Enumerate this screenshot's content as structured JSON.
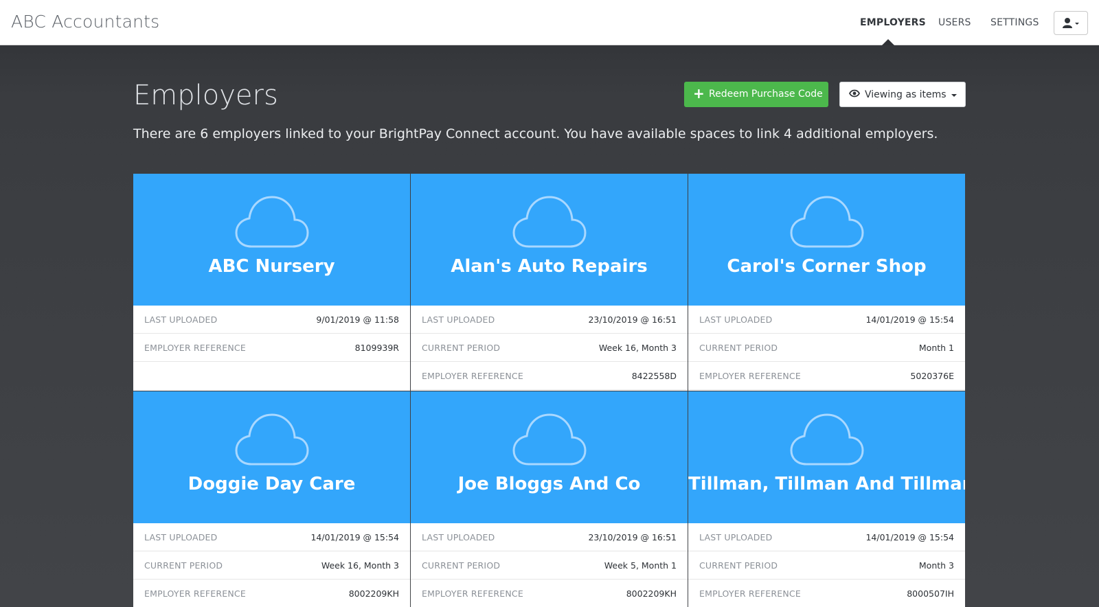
{
  "app": {
    "title": "ABC Accountants"
  },
  "nav": {
    "items": [
      {
        "label": "EMPLOYERS",
        "active": true
      },
      {
        "label": "USERS",
        "active": false
      },
      {
        "label": "SETTINGS",
        "active": false
      }
    ],
    "user_icon": "user-icon"
  },
  "page": {
    "title": "Employers",
    "intro": "There are 6 employers linked to your BrightPay Connect account. You have available spaces to link 4 additional employers."
  },
  "actions": {
    "redeem_label": "Redeem Purchase Code",
    "view_label": "Viewing as items"
  },
  "colors": {
    "card_accent": "#33a6fb",
    "redeem_button": "#4cb84c"
  },
  "employers": [
    {
      "name": "ABC Nursery",
      "rows": [
        {
          "key": "LAST UPLOADED",
          "value": "9/01/2019 @ 11:58"
        },
        {
          "key": "EMPLOYER REFERENCE",
          "value": "8109939R"
        }
      ]
    },
    {
      "name": "Alan's Auto Repairs",
      "rows": [
        {
          "key": "LAST UPLOADED",
          "value": "23/10/2019 @ 16:51"
        },
        {
          "key": "CURRENT PERIOD",
          "value": "Week 16, Month 3"
        },
        {
          "key": "EMPLOYER REFERENCE",
          "value": "8422558D"
        }
      ]
    },
    {
      "name": "Carol's Corner Shop",
      "rows": [
        {
          "key": "LAST UPLOADED",
          "value": "14/01/2019 @ 15:54"
        },
        {
          "key": "CURRENT PERIOD",
          "value": "Month 1"
        },
        {
          "key": "EMPLOYER REFERENCE",
          "value": "5020376E"
        }
      ]
    },
    {
      "name": "Doggie Day Care",
      "rows": [
        {
          "key": "LAST UPLOADED",
          "value": "14/01/2019 @ 15:54"
        },
        {
          "key": "CURRENT PERIOD",
          "value": "Week 16, Month 3"
        },
        {
          "key": "EMPLOYER REFERENCE",
          "value": "8002209KH"
        }
      ]
    },
    {
      "name": "Joe Bloggs And Co",
      "rows": [
        {
          "key": "LAST UPLOADED",
          "value": "23/10/2019 @ 16:51"
        },
        {
          "key": "CURRENT PERIOD",
          "value": "Week 5, Month 1"
        },
        {
          "key": "EMPLOYER REFERENCE",
          "value": "8002209KH"
        }
      ]
    },
    {
      "name": "Tillman, Tillman And Tillman",
      "rows": [
        {
          "key": "LAST UPLOADED",
          "value": "14/01/2019 @ 15:54"
        },
        {
          "key": "CURRENT PERIOD",
          "value": "Month 3"
        },
        {
          "key": "EMPLOYER REFERENCE",
          "value": "8000507IH"
        }
      ]
    }
  ]
}
